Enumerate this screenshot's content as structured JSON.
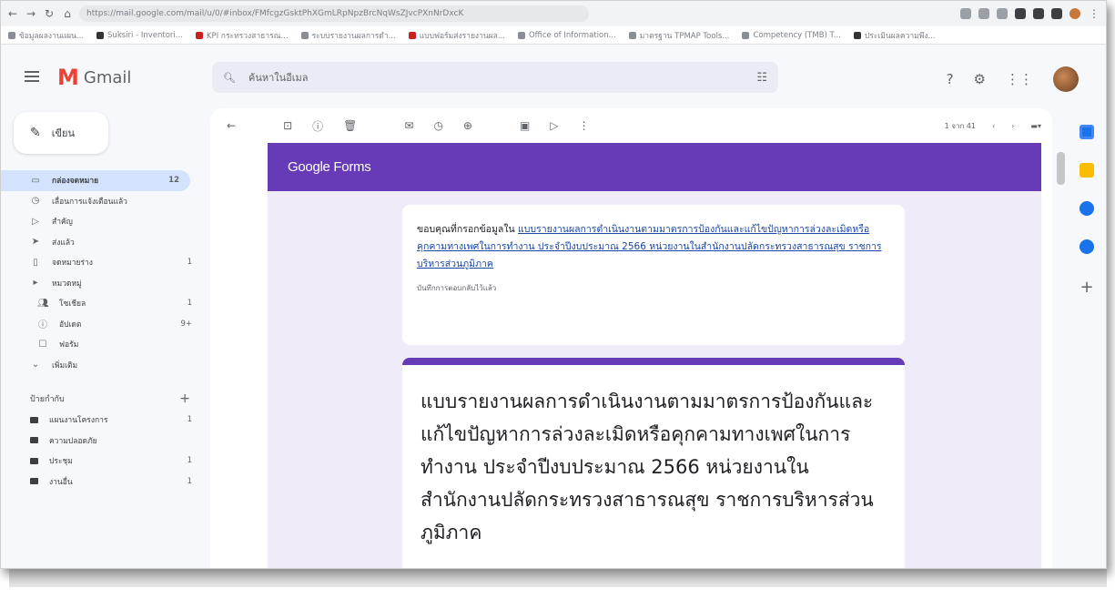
{
  "browser": {
    "url": "https://mail.google.com/mail/u/0/#inbox/FMfcgzGsktPhXGmLRpNpzBrcNqWsZJvcPXnNrDxcK",
    "bookmarks": [
      "ข้อมูลผลงานแผน...",
      "Suksiri - Inventori...",
      "KPI กระทรวงสาธารณ...",
      "ระบบรายงานผลการดำ...",
      "แบบฟอร์มส่งรายงานผล...",
      "Office of Information...",
      "มาตรฐาน TPMAP Tools...",
      "Competency (TMB) T...",
      "ประเมินผลความพึง..."
    ]
  },
  "gmail": {
    "app_name": "Gmail",
    "search_placeholder": "ค้นหาในอีเมล",
    "compose_label": "เขียน",
    "sidebar": [
      {
        "label": "กล่องจดหมาย",
        "count": "12",
        "icon": "inbox-icon"
      },
      {
        "label": "เลื่อนการแจ้งเตือนแล้ว",
        "count": "",
        "icon": "clock-icon"
      },
      {
        "label": "สำคัญ",
        "count": "",
        "icon": "important-icon"
      },
      {
        "label": "ส่งแล้ว",
        "count": "",
        "icon": "send-icon"
      },
      {
        "label": "จดหมายร่าง",
        "count": "1",
        "icon": "draft-icon"
      },
      {
        "label": "หมวดหมู่",
        "count": "",
        "icon": "label-icon"
      },
      {
        "label": "โซเชียล",
        "count": "1",
        "icon": "people-icon"
      },
      {
        "label": "อัปเดต",
        "count": "9+",
        "icon": "info-icon"
      },
      {
        "label": "ฟอรัม",
        "count": "",
        "icon": "forum-icon"
      },
      {
        "label": "เพิ่มเติม",
        "count": "",
        "icon": "chevron-down-icon"
      }
    ],
    "labels_heading": "ป้ายกำกับ",
    "labels": [
      {
        "label": "แผนงานโครงการ",
        "count": "1"
      },
      {
        "label": "ความปลอดภัย",
        "count": ""
      },
      {
        "label": "ประชุม",
        "count": "1"
      },
      {
        "label": "งานอื่น",
        "count": "1"
      }
    ],
    "pager_text": "1 จาก 41"
  },
  "email": {
    "forms_brand": "Google Forms",
    "thanks_prefix": "ขอบคุณที่กรอกข้อมูลใน ",
    "form_link_text": "แบบรายงานผลการดำเนินงานตามมาตรการป้องกันและแก้ไขปัญหาการล่วงละเมิดหรือคุกคามทางเพศในการทำงาน ประจำปีงบประมาณ 2566 หน่วยงานในสำนักงานปลัดกระทรวงสาธารณสุข ราชการบริหารส่วนภูมิภาค",
    "recorded_note": "บันทึกการตอบกลับไว้แล้ว",
    "form_title": "แบบรายงานผลการดำเนินงานตามมาตรการป้องกันและแก้ไขปัญหาการล่วงละเมิดหรือคุกคามทางเพศในการทำงาน ประจำปีงบประมาณ 2566 หน่วยงานในสำนักงานปลัดกระทรวงสาธารณสุข ราชการบริหารส่วนภูมิภาค"
  },
  "colors": {
    "forms_purple": "#673ab7",
    "body_purple_bg": "#f0ebf8",
    "active_nav": "#d3e3fd"
  }
}
